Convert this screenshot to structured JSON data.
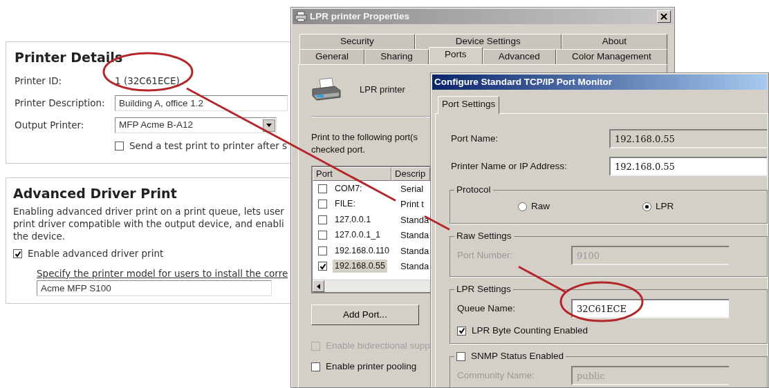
{
  "web_panel": {
    "printer_details": {
      "title": "Printer Details",
      "fields": [
        {
          "label": "Printer ID:",
          "kind": "text",
          "value": "1 (32C61ECE)"
        },
        {
          "label": "Printer Description:",
          "kind": "input",
          "value": "Building A, office 1.2"
        },
        {
          "label": "Output Printer:",
          "kind": "select",
          "value": "MFP Acme B-A12"
        }
      ],
      "test_print": {
        "label": "Send a test print to printer after s",
        "checked": false
      }
    },
    "advanced_driver_print": {
      "title": "Advanced Driver Print",
      "description_lines": [
        "Enabling advanced driver print on a print queue, lets user",
        "print driver compatible with the output device, and enabli",
        "the device."
      ],
      "enable": {
        "label": "Enable advanced driver print",
        "checked": true
      },
      "model_label": "Specify the printer model for users to install the corre",
      "model_value": "Acme MFP S100"
    }
  },
  "properties_window": {
    "title": "LPR printer Properties",
    "tab_rows": [
      [
        {
          "label": "Security",
          "selected": false
        },
        {
          "label": "Device Settings",
          "selected": false
        },
        {
          "label": "About",
          "selected": false
        }
      ],
      [
        {
          "label": "General",
          "selected": false
        },
        {
          "label": "Sharing",
          "selected": false
        },
        {
          "label": "Ports",
          "selected": true
        },
        {
          "label": "Advanced",
          "selected": false
        },
        {
          "label": "Color Management",
          "selected": false
        }
      ]
    ],
    "printer_name": "LPR printer",
    "instructions_lines": [
      "Print to the following port(s",
      "checked port."
    ],
    "port_table": {
      "columns": [
        "Port",
        "Descrip"
      ],
      "rows": [
        {
          "port": "COM7:",
          "description": "Serial",
          "checked": false,
          "selected": false
        },
        {
          "port": "FILE:",
          "description": "Print t",
          "checked": false,
          "selected": false
        },
        {
          "port": "127.0.0.1",
          "description": "Standa",
          "checked": false,
          "selected": false
        },
        {
          "port": "127.0.0.1_1",
          "description": "Standa",
          "checked": false,
          "selected": false
        },
        {
          "port": "192.168.0.110",
          "description": "Standa",
          "checked": false,
          "selected": false
        },
        {
          "port": "192.168.0.55",
          "description": "Standa",
          "checked": true,
          "selected": true
        }
      ]
    },
    "buttons": [
      "Add Port..."
    ],
    "options": [
      {
        "label": "Enable bidirectional supp",
        "checked": false,
        "disabled": true
      },
      {
        "label": "Enable printer pooling",
        "checked": false,
        "disabled": false
      }
    ]
  },
  "port_dialog": {
    "title": "Configure Standard TCP/IP Port Monitor",
    "tabs": [
      {
        "label": "Port Settings",
        "selected": true
      }
    ],
    "fields": [
      {
        "label": "Port Name:",
        "value": "192.168.0.55",
        "kind": "readonly"
      },
      {
        "label": "Printer Name or IP Address:",
        "value": "192.168.0.55",
        "kind": "input"
      }
    ],
    "protocol": {
      "title": "Protocol",
      "options": [
        {
          "label": "Raw",
          "selected": false
        },
        {
          "label": "LPR",
          "selected": true
        }
      ]
    },
    "raw_settings": {
      "title": "Raw Settings",
      "label": "Port Number:",
      "value": "9100",
      "disabled": true
    },
    "lpr_settings": {
      "title": "LPR Settings",
      "label": "Queue Name:",
      "value": "32C61ECE",
      "byte_counting": {
        "label": "LPR Byte Counting Enabled",
        "checked": true
      }
    },
    "snmp": {
      "label": "SNMP Status Enabled",
      "checked": false,
      "community_label": "Community Name:",
      "community_value": "public",
      "disabled": true
    }
  }
}
